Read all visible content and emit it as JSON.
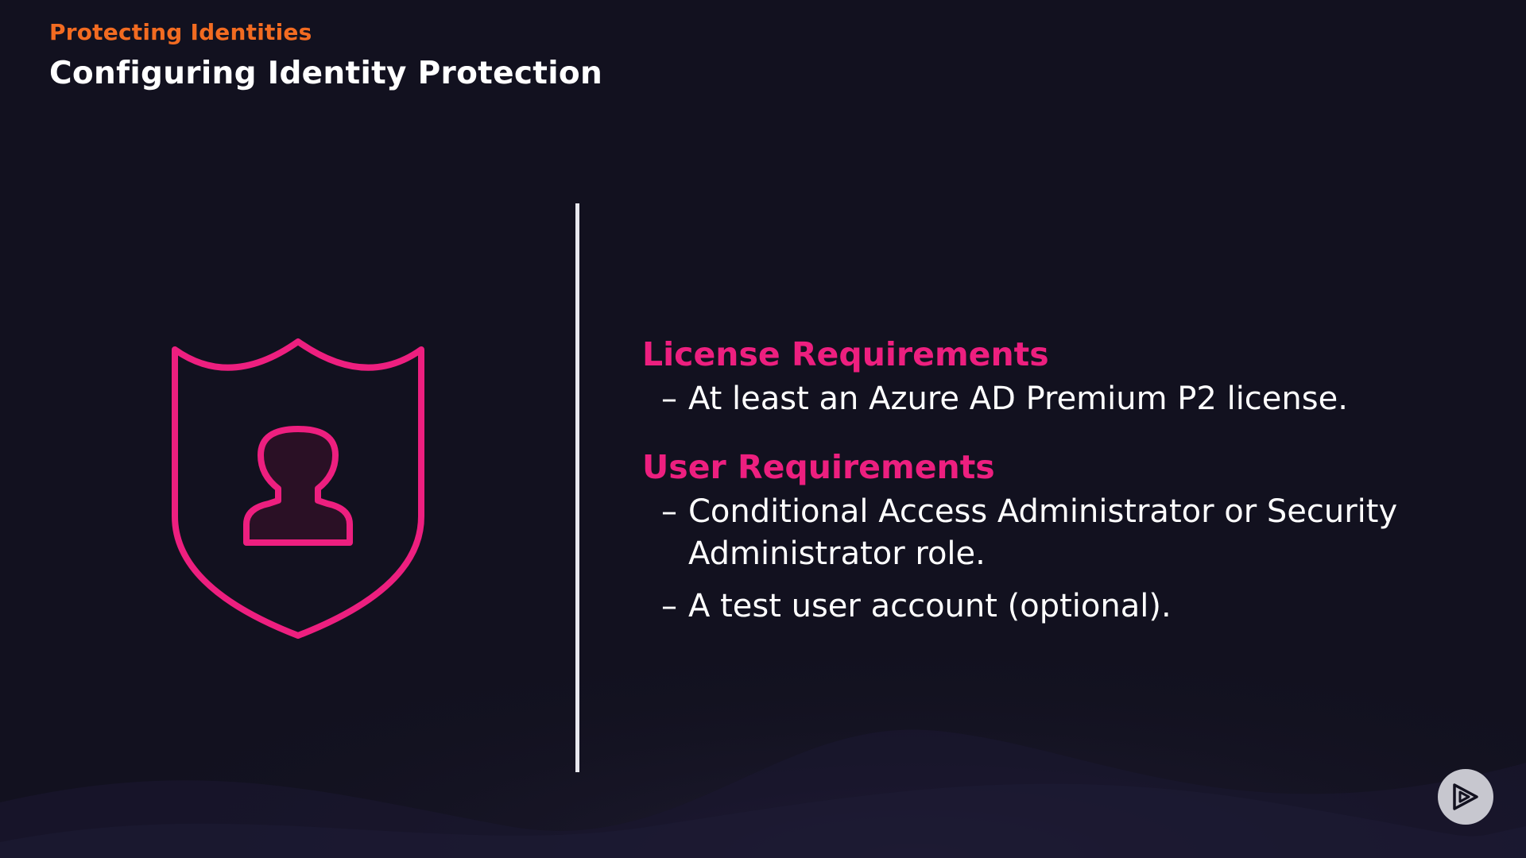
{
  "header": {
    "kicker": "Protecting Identities",
    "title": "Configuring Identity Protection"
  },
  "sections": [
    {
      "heading": "License Requirements",
      "items": [
        "At least an Azure AD Premium P2 license."
      ]
    },
    {
      "heading": "User Requirements",
      "items": [
        "Conditional Access Administrator or Security Administrator role.",
        "A test user account (optional)."
      ]
    }
  ],
  "bullet_glyph": "–",
  "icons": {
    "illustration": "shield-user-icon",
    "badge": "play-logo-icon"
  },
  "colors": {
    "background": "#12111f",
    "kicker": "#f26b21",
    "title": "#ffffff",
    "heading": "#ed1f7f",
    "shield_stroke": "#ed1f7f",
    "divider": "#e8e8ee",
    "body_text": "#ffffff",
    "badge": "#c7c7cf"
  }
}
